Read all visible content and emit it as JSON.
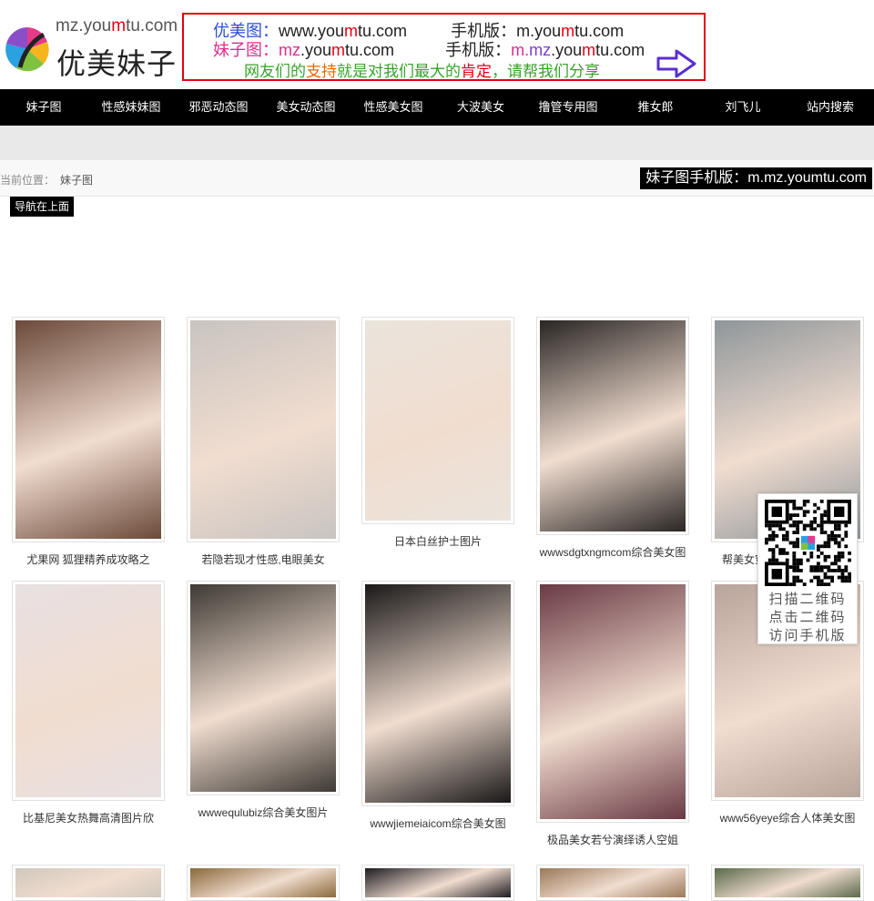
{
  "header": {
    "logo_url_prefix": "mz.you",
    "logo_url_mid": "m",
    "logo_url_suffix": "tu.com",
    "logo_title": "优美妹子"
  },
  "ad": {
    "line1_label": "优美图：",
    "line1_url_a": "www.you",
    "line1_url_m": "m",
    "line1_url_b": "tu.com",
    "line1_mobile_label": "手机版：",
    "line1_mobile_a": "m.you",
    "line1_mobile_m": "m",
    "line1_mobile_b": "tu.com",
    "line2_label": "妹子图：",
    "line2_url_a": "mz",
    "line2_url_b": ".you",
    "line2_url_m": "m",
    "line2_url_c": "tu.com",
    "line2_mobile_label": "手机版：",
    "line2_mobile_a": "m.",
    "line2_mobile_b": "mz",
    "line2_mobile_c": ".you",
    "line2_mobile_m": "m",
    "line2_mobile_d": "tu.com",
    "line3_a": "网友们的",
    "line3_b": "支持",
    "line3_c": "就是对我们最大的",
    "line3_d": "肯定",
    "line3_e": "，请帮我们分享"
  },
  "nav": {
    "items": [
      "妹子图",
      "性感妹妹图",
      "邪恶动态图",
      "美女动态图",
      "性感美女图",
      "大波美女",
      "撸管专用图",
      "推女郎",
      "刘飞儿",
      "站内搜索"
    ]
  },
  "breadcrumb": {
    "label": "当前位置：",
    "current": "妹子图"
  },
  "mobile_tag": "妹子图手机版：m.mz.youmtu.com",
  "nav_top_tag": "导航在上面",
  "cards": [
    {
      "caption": "尤果网 狐狸精养成攻略之",
      "bg": "#6b4a3a"
    },
    {
      "caption": "若隐若现才性感,电眼美女",
      "bg": "#c9c4c0"
    },
    {
      "caption": "日本白丝护士图片",
      "bg": "#eae4dc"
    },
    {
      "caption": "wwwsdgtxngmcom综合美女图",
      "bg": "#2a2624"
    },
    {
      "caption": "帮美女穿睡衣性感尤物美女",
      "bg": "#8f969a"
    },
    {
      "caption": "比基尼美女热舞高清图片欣",
      "bg": "#e8e0e2"
    },
    {
      "caption": "wwwequlubiz综合美女图片",
      "bg": "#3e3a34"
    },
    {
      "caption": "wwwjiemeiaicom综合美女图",
      "bg": "#1a1818"
    },
    {
      "caption": "极品美女若兮演绎诱人空姐",
      "bg": "#6a3a44"
    },
    {
      "caption": "www56yeye综合人体美女图",
      "bg": "#b8a49a"
    },
    {
      "caption": "",
      "bg": "#d0c8bc"
    },
    {
      "caption": "",
      "bg": "#8a6a3a"
    },
    {
      "caption": "",
      "bg": "#1e1c22"
    },
    {
      "caption": "",
      "bg": "#9a7a5a"
    },
    {
      "caption": "",
      "bg": "#5a6a4a"
    }
  ],
  "qr": {
    "line1": "扫描二维码",
    "line2": "点击二维码",
    "line3": "访问手机版"
  }
}
